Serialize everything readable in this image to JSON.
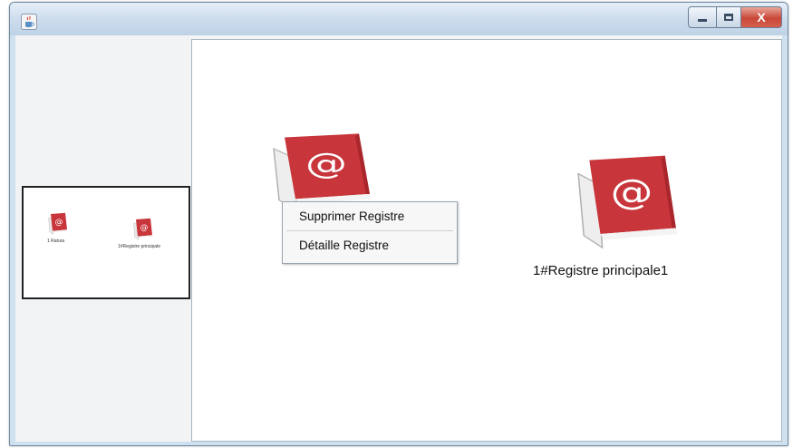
{
  "window": {
    "icon": "java-cup-icon",
    "controls": {
      "minimize_icon": "minimize-icon",
      "maximize_icon": "maximize-icon",
      "close_label": "X"
    }
  },
  "overview": {
    "items": [
      {
        "label": "1 Ratura",
        "icon": "address-book-icon"
      },
      {
        "label": "1#Registre principale",
        "icon": "address-book-icon"
      }
    ]
  },
  "canvas": {
    "books": [
      {
        "icon": "address-book-icon",
        "label": ""
      },
      {
        "icon": "address-book-icon",
        "label": "1#Registre principale1"
      }
    ]
  },
  "context_menu": {
    "items": [
      "Supprimer Registre",
      "Détaille Registre"
    ]
  },
  "colors": {
    "book_red": "#c8353a",
    "book_spine": "#e8e8e8",
    "titlebar": "#cfdeee",
    "close_red": "#c9473a"
  }
}
